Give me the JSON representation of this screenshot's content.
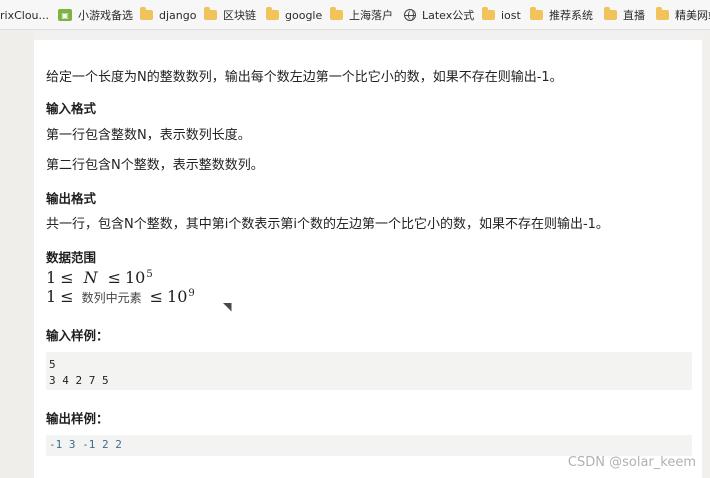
{
  "browser": {
    "bookmarks": [
      {
        "label": "rixClou...",
        "icon": "bookmark-icon"
      },
      {
        "label": "小游戏备选",
        "icon": "gamepad-icon"
      },
      {
        "label": "django",
        "icon": "folder-icon"
      },
      {
        "label": "区块链",
        "icon": "folder-icon"
      },
      {
        "label": "google",
        "icon": "folder-icon"
      },
      {
        "label": "上海落户",
        "icon": "folder-icon"
      },
      {
        "label": "Latex公式",
        "icon": "globe-icon"
      },
      {
        "label": "iost",
        "icon": "folder-icon"
      },
      {
        "label": "推荐系统",
        "icon": "folder-icon"
      },
      {
        "label": "直播",
        "icon": "folder-icon"
      },
      {
        "label": "精美网站",
        "icon": "folder-icon"
      }
    ]
  },
  "problem": {
    "description": "给定一个长度为N的整数数列，输出每个数左边第一个比它小的数，如果不存在则输出-1。",
    "input_format_title": "输入格式",
    "input_format_line1": "第一行包含整数N，表示数列长度。",
    "input_format_line2": "第二行包含N个整数，表示整数数列。",
    "output_format_title": "输出格式",
    "output_format_line1": "共一行，包含N个整数，其中第i个数表示第i个数的左边第一个比它小的数，如果不存在则输出-1。",
    "data_range_title": "数据范围",
    "range1": {
      "left": "1",
      "op1": "≤",
      "var": "N",
      "op2": "≤",
      "base": "10",
      "exp": "5"
    },
    "range2": {
      "left": "1",
      "op1": "≤",
      "middle": "数列中元素",
      "op2": "≤",
      "base": "10",
      "exp": "9"
    },
    "sample_input_title": "输入样例：",
    "sample_input_lines": [
      "5",
      "3 4 2 7 5"
    ],
    "sample_output_title": "输出样例：",
    "sample_output_line": "-1 3 -1 2 2"
  },
  "watermark": "CSDN @solar_keem",
  "colors": {
    "background": "#ffffff",
    "code_background": "#f3f4f2",
    "output_code_text": "#3b6d8c",
    "folder": "#f1c35a"
  }
}
